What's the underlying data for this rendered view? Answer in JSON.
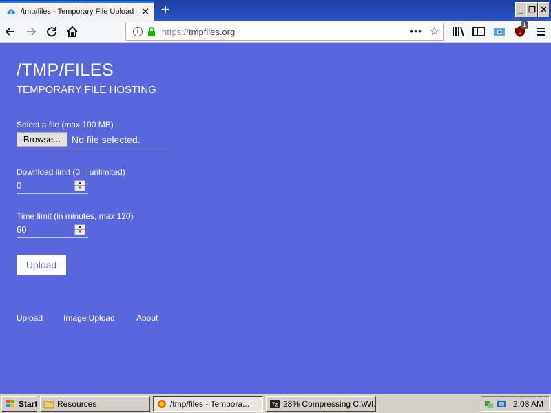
{
  "browser": {
    "tab_title": "/tmp/files - Temporary File Upload",
    "tab_close": "✕",
    "new_tab": "+",
    "url_scheme": "https://",
    "url_host": "tmpfiles.org",
    "page_actions": "•••",
    "addon_badge": "1",
    "window_buttons": [
      "_",
      "❐",
      "✕"
    ]
  },
  "page": {
    "title": "/TMP/FILES",
    "subtitle": "TEMPORARY FILE HOSTING",
    "file_label": "Select a file (max 100 MB)",
    "browse_label": "Browse...",
    "file_status": "No file selected.",
    "download_label": "Download limit (0 = unlimited)",
    "download_value": "0",
    "time_label": "Time limit (in minutes, max 120)",
    "time_value": "60",
    "upload_button": "Upload",
    "footer_links": [
      "Upload",
      "Image Upload",
      "About"
    ]
  },
  "taskbar": {
    "start": "Start",
    "items": [
      "Resources",
      "/tmp/files - Tempora...",
      "28% Compressing C:\\WI..."
    ],
    "clock": "2:08 AM"
  },
  "colors": {
    "page_bg": "#5a67dc",
    "accent": "#0a84ff"
  }
}
